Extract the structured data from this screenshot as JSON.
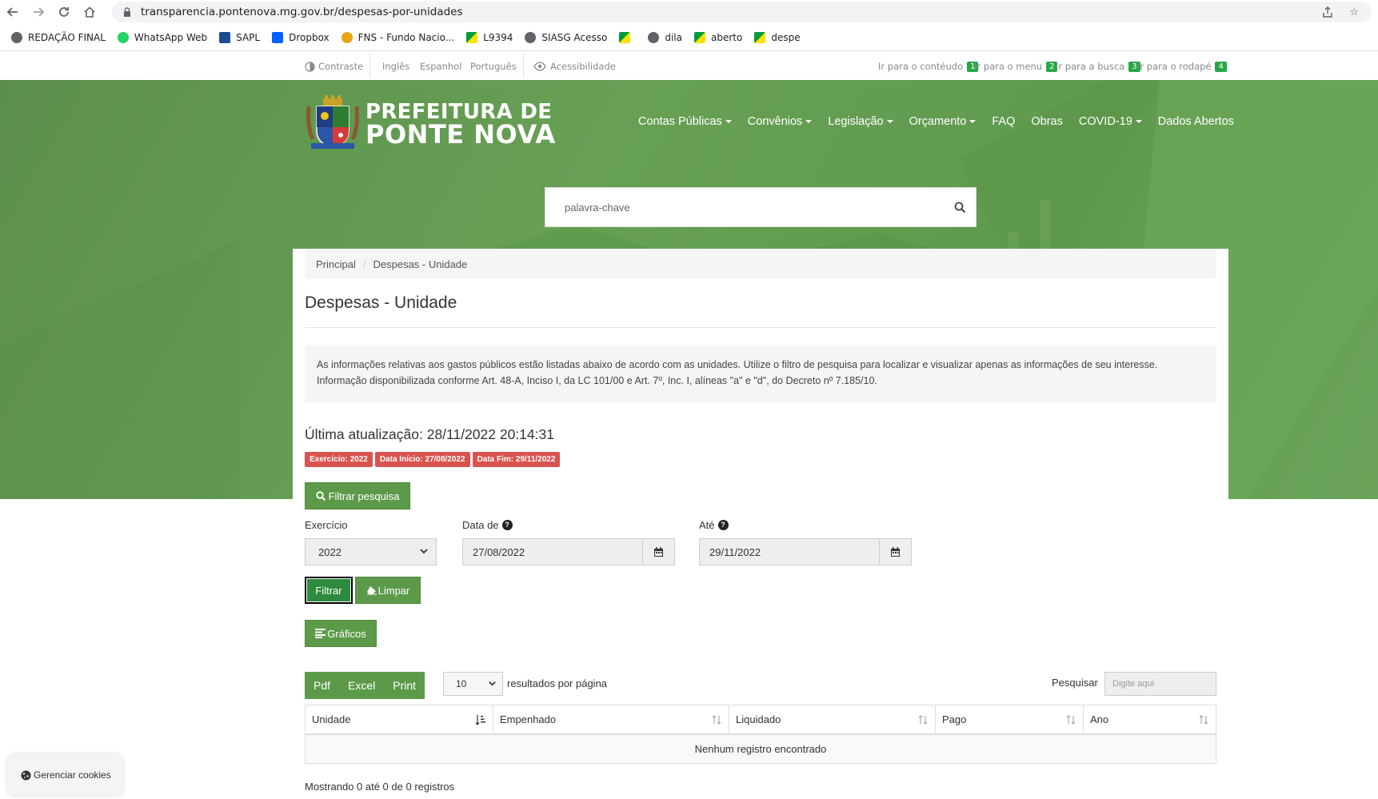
{
  "browser": {
    "url": "transparencia.pontenova.mg.gov.br/despesas-por-unidades",
    "bookmarks": [
      {
        "label": "REDAÇÃO FINAL",
        "icon": "globe"
      },
      {
        "label": "WhatsApp Web",
        "icon": "wa"
      },
      {
        "label": "SAPL",
        "icon": "sapl"
      },
      {
        "label": "Dropbox",
        "icon": "dropbox"
      },
      {
        "label": "FNS - Fundo Nacio...",
        "icon": "fns"
      },
      {
        "label": "L9394",
        "icon": "flag"
      },
      {
        "label": "SIASG Acesso",
        "icon": "globe"
      },
      {
        "label": "",
        "icon": "flag"
      },
      {
        "label": "dila",
        "icon": "globe"
      },
      {
        "label": "aberto",
        "icon": "flag"
      },
      {
        "label": "despe",
        "icon": "flag"
      }
    ]
  },
  "accessibility": {
    "contrast": "Contraste",
    "lang_en": "Inglês",
    "lang_es": "Espanhol",
    "lang_pt": "Português",
    "accessibility": "Acessibilidade",
    "skip_content": "Ir para o contéudo",
    "skip_content_key": "1",
    "skip_menu": "Ir para o menu",
    "skip_menu_key": "2",
    "skip_search": "Ir para a busca",
    "skip_search_key": "3",
    "skip_footer": "Ir para o rodapé",
    "skip_footer_key": "4"
  },
  "header": {
    "logo_line1": "PREFEITURA DE",
    "logo_line2": "PONTE NOVA",
    "nav": [
      {
        "label": "Contas Públicas",
        "dropdown": true
      },
      {
        "label": "Convênios",
        "dropdown": true
      },
      {
        "label": "Legislação",
        "dropdown": true
      },
      {
        "label": "Orçamento",
        "dropdown": true
      },
      {
        "label": "FAQ",
        "dropdown": false
      },
      {
        "label": "Obras",
        "dropdown": false
      },
      {
        "label": "COVID-19",
        "dropdown": true
      },
      {
        "label": "Dados Abertos",
        "dropdown": false
      }
    ],
    "search_placeholder": "palavra-chave"
  },
  "breadcrumb": {
    "home": "Principal",
    "current": "Despesas - Unidade"
  },
  "page": {
    "title": "Despesas - Unidade",
    "info": "As informações relativas aos gastos públicos estão listadas abaixo de acordo com as unidades. Utilize o filtro de pesquisa para localizar e visualizar apenas as informações de seu interesse. Informação disponibilizada conforme Art. 48-A, Inciso I, da LC 101/00 e Art. 7º, Inc. I, alíneas \"a\" e \"d\", do Decreto nº 7.185/10.",
    "updated": "Última atualização: 28/11/2022 20:14:31",
    "labels": [
      "Exercício: 2022",
      "Data Início: 27/08/2022",
      "Data Fim: 29/11/2022"
    ]
  },
  "filter": {
    "toggle_label": "Filtrar pesquisa",
    "exercicio_label": "Exercício",
    "exercicio_value": "2022",
    "data_de_label": "Data de",
    "data_de_value": "27/08/2022",
    "ate_label": "Até",
    "ate_value": "29/11/2022",
    "filtrar": "Filtrar",
    "limpar": "Limpar",
    "graficos": "Gráficos"
  },
  "table": {
    "export": [
      "Pdf",
      "Excel",
      "Print"
    ],
    "page_size": "10",
    "page_size_label": "resultados por página",
    "search_label": "Pesquisar",
    "search_placeholder": "Digite aqui",
    "columns": [
      "Unidade",
      "Empenhado",
      "Liquidado",
      "Pago",
      "Ano"
    ],
    "empty": "Nenhum registro encontrado",
    "info": "Mostrando 0 até 0 de 0 registros"
  },
  "cookies": {
    "label": "Gerenciar cookies"
  },
  "colors": {
    "brand_green": "#5c9a4a",
    "label_red": "#d9534f",
    "skip_key_green": "#28a745"
  }
}
